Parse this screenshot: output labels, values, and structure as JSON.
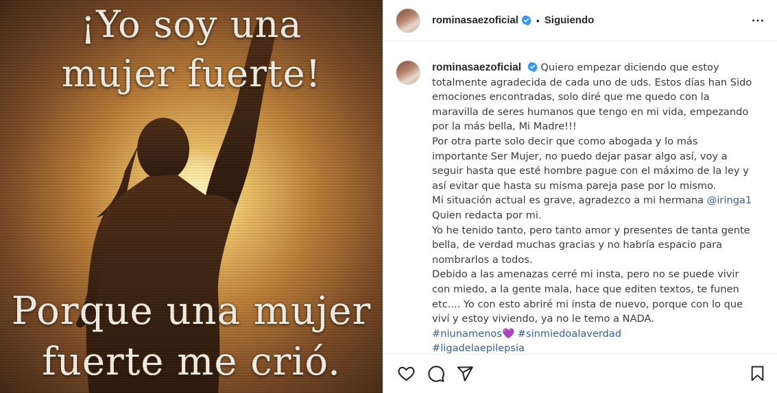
{
  "media": {
    "quote_top": [
      "¡Yo soy una",
      "mujer fuerte!"
    ],
    "quote_bottom": [
      "Porque una mujer",
      "fuerte me crió."
    ]
  },
  "header": {
    "username": "rominasaezoficial",
    "dot": "•",
    "follow_state": "Siguiendo",
    "more_icon": "ellipsis-icon"
  },
  "caption": {
    "username": "rominasaezoficial",
    "lines": [
      "Quiero empezar diciendo que estoy totalmente agradecida de cada uno de uds. Estos días han Sido emociones encontradas, solo diré que me quedo con la maravilla de seres humanos que tengo en mi vida, empezando por la más bella, Mi Madre!!!",
      "Por otra parte solo decir que como abogada y lo más importante Ser Mujer, no puedo dejar pasar algo así, voy a seguir hasta que esté hombre pague con el máximo de la ley y así evitar que hasta su misma pareja pase por lo mismo."
    ],
    "situation_pre": "Mi situación actual es grave, agradezco a mi hermana ",
    "mention": "@iringa1",
    "situation_post": "Quien redacta por mi.",
    "love": "Yo he tenido tanto, pero tanto amor y presentes de tanta gente bella, de verdad muchas gracias y no habría espacio para nombrarlos a todos.",
    "threats": "Debido a las amenazas cerré mi insta, pero no se puede vivir con miedo, a la gente mala, hace que editen textos, te funen etc.... Yo con esto abriré mi insta de nuevo, porque con lo que viví y estoy viviendo, ya no le temo a NADA.",
    "hashtags": {
      "tag1": "#niunamenos",
      "heart": "💜",
      "tag2": "#sinmiedoalaverdad",
      "tag3": "#ligadelaepilepsia"
    }
  },
  "actions": {
    "like_icon": "heart-icon",
    "comment_icon": "comment-icon",
    "share_icon": "share-icon",
    "save_icon": "bookmark-icon"
  },
  "colors": {
    "verified": "#3897f0",
    "link": "#3a5f8f",
    "text": "#262626"
  }
}
